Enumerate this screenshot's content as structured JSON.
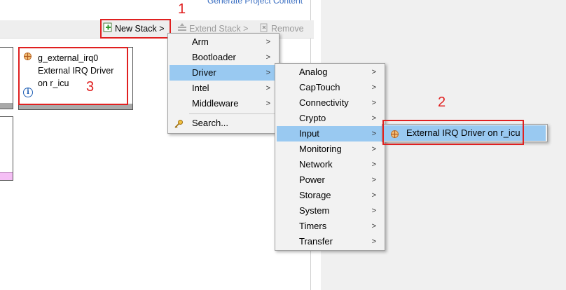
{
  "header": {
    "generate_link": "Generate Project Content"
  },
  "toolbar": {
    "new_stack": "New Stack >",
    "extend_stack": "Extend Stack >",
    "remove": "Remove"
  },
  "stack_card": {
    "name": "g_external_irq0",
    "line2": "External IRQ Driver",
    "line3": "on r_icu"
  },
  "annotations": [
    "1",
    "2",
    "3"
  ],
  "menu1": {
    "items": [
      {
        "label": "Arm"
      },
      {
        "label": "Bootloader"
      },
      {
        "label": "Driver"
      },
      {
        "label": "Intel"
      },
      {
        "label": "Middleware"
      },
      {
        "label": "Search..."
      }
    ]
  },
  "menu2": {
    "items": [
      {
        "label": "Analog"
      },
      {
        "label": "CapTouch"
      },
      {
        "label": "Connectivity"
      },
      {
        "label": "Crypto"
      },
      {
        "label": "Input"
      },
      {
        "label": "Monitoring"
      },
      {
        "label": "Network"
      },
      {
        "label": "Power"
      },
      {
        "label": "Storage"
      },
      {
        "label": "System"
      },
      {
        "label": "Timers"
      },
      {
        "label": "Transfer"
      }
    ]
  },
  "menu3": {
    "items": [
      {
        "label": "External IRQ Driver on r_icu"
      }
    ]
  },
  "colors": {
    "highlight": "#99c9f1",
    "annotation": "#e02020",
    "link": "#3b6fc2"
  }
}
